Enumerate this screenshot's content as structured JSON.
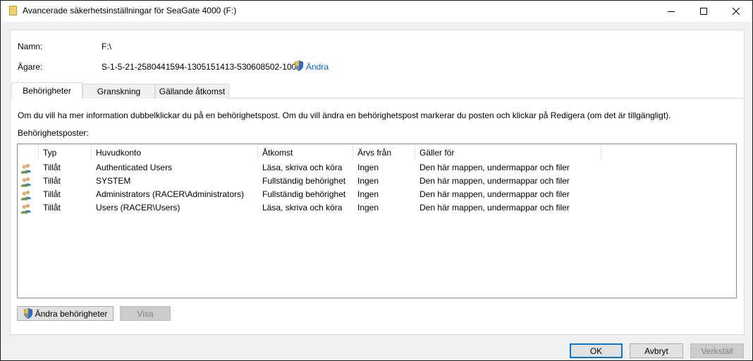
{
  "window": {
    "title": "Avancerade säkerhetsinställningar för SeaGate 4000 (F:)"
  },
  "fields": {
    "name_label": "Namn:",
    "name_value": "F:\\",
    "owner_label": "Ägare:",
    "owner_value": "S-1-5-21-2580441594-1305151413-530608502-1000",
    "change_owner_link": "Ändra"
  },
  "tabs": [
    {
      "label": "Behörigheter",
      "active": true
    },
    {
      "label": "Granskning",
      "active": false
    },
    {
      "label": "Gällande åtkomst",
      "active": false
    }
  ],
  "info_text": "Om du vill ha mer information dubbelklickar du på en behörighetspost. Om du vill ändra en behörighetspost markerar du posten och klickar på Redigera (om det är tillgängligt).",
  "entries_label": "Behörighetsposter:",
  "table": {
    "columns": [
      "Typ",
      "Huvudkonto",
      "Åtkomst",
      "Ärvs från",
      "Gäller för"
    ],
    "rows": [
      {
        "type": "Tillåt",
        "principal": "Authenticated Users",
        "access": "Läsa, skriva och köra",
        "inherited": "Ingen",
        "applies": "Den här mappen, undermappar och filer"
      },
      {
        "type": "Tillåt",
        "principal": "SYSTEM",
        "access": "Fullständig behörighet",
        "inherited": "Ingen",
        "applies": "Den här mappen, undermappar och filer"
      },
      {
        "type": "Tillåt",
        "principal": "Administrators (RACER\\Administrators)",
        "access": "Fullständig behörighet",
        "inherited": "Ingen",
        "applies": "Den här mappen, undermappar och filer"
      },
      {
        "type": "Tillåt",
        "principal": "Users (RACER\\Users)",
        "access": "Läsa, skriva och köra",
        "inherited": "Ingen",
        "applies": "Den här mappen, undermappar och filer"
      }
    ]
  },
  "buttons": {
    "change_permissions": "Ändra behörigheter",
    "view": "Visa",
    "ok": "OK",
    "cancel": "Avbryt",
    "apply": "Verkställ"
  },
  "icons": {
    "folder": "folder-icon",
    "shield": "uac-shield-icon",
    "user": "user-group-icon"
  },
  "colors": {
    "link": "#0066cc",
    "default_button_border": "#0078d7"
  }
}
